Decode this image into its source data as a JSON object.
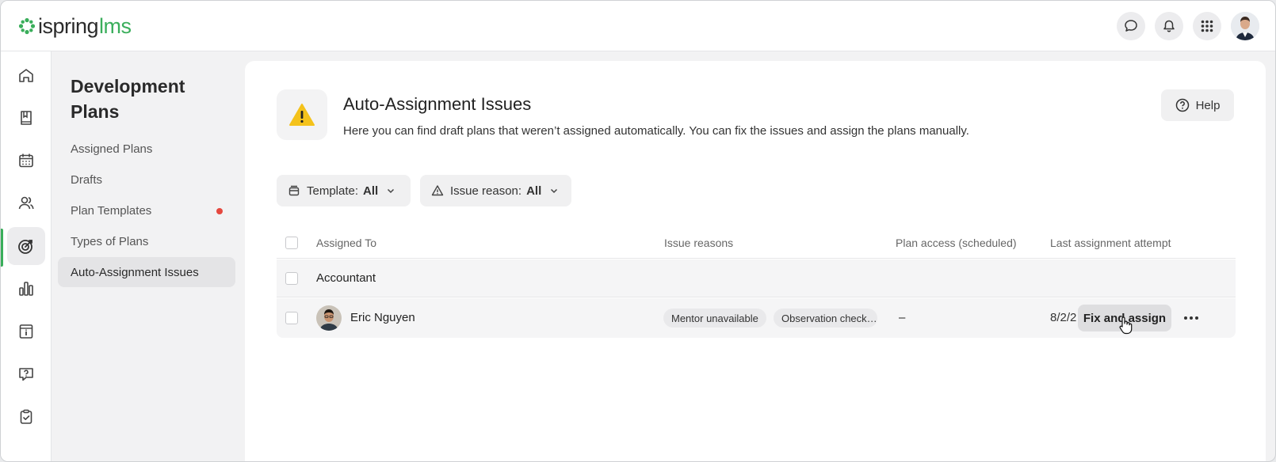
{
  "brand": {
    "part1": "ispring",
    "part2": "lms",
    "accent": "#3aae5b"
  },
  "topbar": {
    "icons": [
      "chat-icon",
      "bell-icon",
      "apps-grid-icon"
    ],
    "avatar": "user-avatar"
  },
  "rail": {
    "items": [
      "home-icon",
      "book-icon",
      "calendar-icon",
      "users-icon",
      "target-icon",
      "bar-chart-icon",
      "info-card-icon",
      "question-chat-icon",
      "clipboard-check-icon"
    ],
    "active_index": 4
  },
  "subnav": {
    "title": "Development Plans",
    "items": [
      {
        "label": "Assigned Plans"
      },
      {
        "label": "Drafts"
      },
      {
        "label": "Plan Templates",
        "has_dot": true
      },
      {
        "label": "Types of Plans"
      },
      {
        "label": "Auto-Assignment Issues",
        "active": true
      }
    ]
  },
  "page": {
    "title": "Auto-Assignment Issues",
    "description": "Here you can find draft plans that weren’t assigned automatically. You can fix the issues and assign the plans manually.",
    "help_label": "Help"
  },
  "filters": [
    {
      "label": "Template:",
      "value": "All"
    },
    {
      "label": "Issue reason:",
      "value": "All"
    }
  ],
  "table": {
    "columns": [
      "Assigned To",
      "Issue reasons",
      "Plan access (scheduled)",
      "Last assignment attempt"
    ],
    "group": {
      "label": "Accountant"
    },
    "rows": [
      {
        "name": "Eric Nguyen",
        "issue_reasons": [
          "Mentor unavailable",
          "Observation check…"
        ],
        "plan_access": "–",
        "last_attempt": "8/2/2",
        "action_label": "Fix and assign"
      }
    ]
  }
}
